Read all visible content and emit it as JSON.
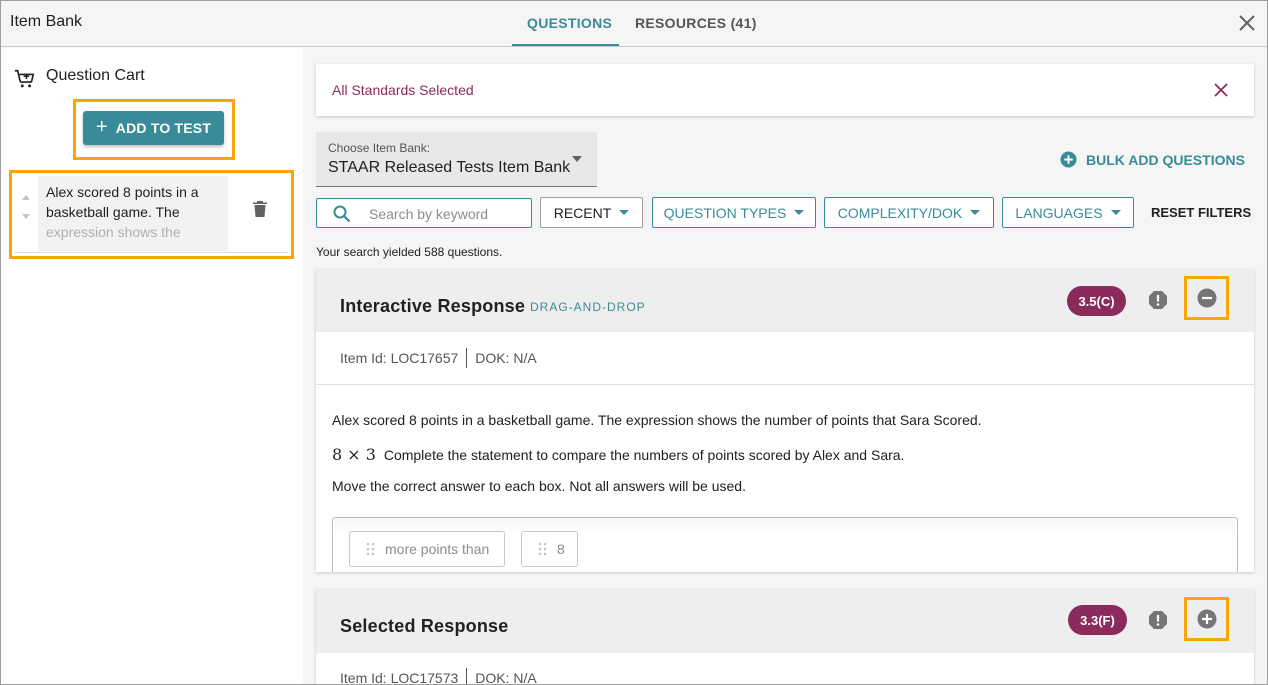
{
  "header": {
    "title": "Item Bank",
    "tabs": [
      {
        "label": "QUESTIONS",
        "active": true
      },
      {
        "label": "RESOURCES (41)",
        "active": false
      }
    ]
  },
  "sidebar": {
    "cart_title": "Question Cart",
    "add_button": "ADD TO TEST",
    "items": [
      {
        "line1": "Alex scored 8 points in a",
        "line2": "basketball game. The",
        "line3": "expression shows the"
      }
    ]
  },
  "main": {
    "standards_text": "All Standards Selected",
    "item_bank_label": "Choose Item Bank:",
    "item_bank_value": "STAAR Released Tests Item Bank",
    "bulk_add": "BULK ADD QUESTIONS",
    "search_placeholder": "Search by keyword",
    "filters": [
      "RECENT",
      "QUESTION TYPES",
      "COMPLEXITY/DOK",
      "LANGUAGES"
    ],
    "reset_filters": "RESET FILTERS",
    "results_text": "Your search yielded 588 questions.",
    "cards": [
      {
        "title": "Interactive Response",
        "subtitle": "DRAG-AND-DROP",
        "badge": "3.5(C)",
        "action": "remove",
        "item_id": "Item Id: LOC17657",
        "dok": "DOK: N/A",
        "stem1": "Alex scored 8 points in a basketball game. The expression shows the number of points that Sara Scored.",
        "math": "8 × 3",
        "stem2": "Complete the statement to compare the numbers of points scored by Alex and Sara.",
        "stem3": "Move the correct answer to each box. Not all answers will be used.",
        "choices": [
          "more points than",
          "8"
        ]
      },
      {
        "title": "Selected Response",
        "badge": "3.3(F)",
        "action": "add",
        "item_id": "Item Id: LOC17573",
        "dok": "DOK: N/A"
      }
    ]
  },
  "colors": {
    "accent": "#3a8b99",
    "badge": "#8a2b5c",
    "highlight": "#f7a800"
  }
}
